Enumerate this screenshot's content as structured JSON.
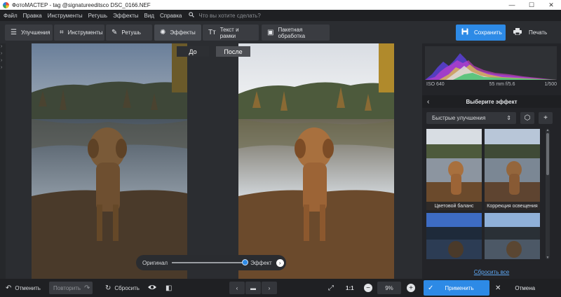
{
  "window": {
    "title": "ФотоМАСТЕР - tag @signatureeditsco DSC_0166.NEF",
    "minimize_glyph": "—",
    "maximize_glyph": "☐",
    "close_glyph": "✕"
  },
  "menu": {
    "items": [
      "Файл",
      "Правка",
      "Инструменты",
      "Ретушь",
      "Эффекты",
      "Вид",
      "Справка"
    ],
    "search_placeholder": "Что вы хотите сделать?"
  },
  "toolbar": {
    "tabs": [
      {
        "label": "Улучшения",
        "icon": "sliders-icon",
        "glyph": "☰"
      },
      {
        "label": "Инструменты",
        "icon": "crop-icon",
        "glyph": "⌗"
      },
      {
        "label": "Ретушь",
        "icon": "brush-icon",
        "glyph": "✎"
      },
      {
        "label": "Эффекты",
        "icon": "sparkle-icon",
        "glyph": "✺",
        "active": true
      },
      {
        "label": "Текст и рамки",
        "icon": "text-icon",
        "glyph": "Tт"
      },
      {
        "label": "Пакетная обработка",
        "icon": "batch-icon",
        "glyph": "▣"
      }
    ],
    "save_label": "Сохранить",
    "print_label": "Печать",
    "accent_color": "#2d8ae6"
  },
  "left_strip_glyphs": [
    "›",
    "›",
    "›",
    "›"
  ],
  "preview": {
    "before_label": "До",
    "after_label": "После",
    "slider": {
      "left_label": "Оригинал",
      "right_label": "Эффект",
      "value": 1.0,
      "arrow_glyph": "›"
    }
  },
  "histogram": {
    "iso": "ISO 640",
    "lens": "55 mm f/5.6",
    "shutter": "1/500"
  },
  "effects_panel": {
    "title": "Выберите эффект",
    "back_glyph": "‹",
    "category": "Быстрые улучшения",
    "category_chevron": "⇕",
    "cube_glyph": "⬡",
    "add_glyph": "+",
    "thumbnails": [
      {
        "caption": "Цветовой баланс"
      },
      {
        "caption": "Коррекция освещения"
      },
      {
        "caption": ""
      },
      {
        "caption": ""
      }
    ],
    "reset_all": "Сбросить все"
  },
  "bottom": {
    "undo": "Отменить",
    "undo_glyph": "↶",
    "redo": "Повторить",
    "redo_glyph": "↷",
    "reset": "Сбросить",
    "reset_glyph": "↻",
    "eye_glyph": "👁",
    "compare_glyph": "◧",
    "prev_glyph": "‹",
    "folder_glyph": "▬",
    "next_glyph": "›",
    "fit_glyph": "⤢",
    "one_to_one": "1:1",
    "zoom_out_glyph": "−",
    "zoom": "9%",
    "zoom_in_glyph": "+",
    "apply": "Применить",
    "apply_glyph": "✓",
    "cancel": "Отмена",
    "cancel_glyph": "✕"
  }
}
